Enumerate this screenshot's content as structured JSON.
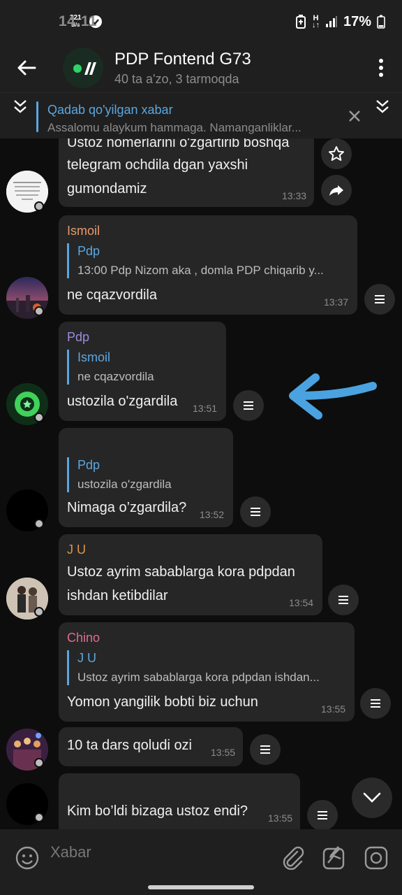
{
  "status": {
    "time": "14:11",
    "net_speed_value": "321",
    "net_speed_unit": "B/s",
    "battery": "17%"
  },
  "header": {
    "title": "PDP Fontend G73",
    "subtitle": "40 ta a'zo, 3 tarmoqda"
  },
  "pinned": {
    "title": "Qadab qo'yilgan xabar",
    "text": "Assalomu alaykum hammaga. Namanganliklar..."
  },
  "messages": [
    {
      "lines": [
        "Ustoz nomerlarini o'zgartirib boshqa",
        "telegram ochdila dgan yaxshi",
        "gumondamiz"
      ],
      "time": "13:33"
    },
    {
      "sender": "Ismoil",
      "reply_name": "Pdp",
      "reply_text": "13:00 Pdp Nizom aka , domla PDP chiqarib y...",
      "text": "ne cqazvordila",
      "time": "13:37"
    },
    {
      "sender": "Pdp",
      "reply_name": "Ismoil",
      "reply_text": "ne cqazvordila",
      "text": "ustozila o'zgardila",
      "time": "13:51"
    },
    {
      "reply_name": "Pdp",
      "reply_text": "ustozila o'zgardila",
      "text": "Nimaga o’zgardila?",
      "time": "13:52"
    },
    {
      "sender": "J U",
      "lines": [
        "Ustoz ayrim sabablarga kora pdpdan",
        "ishdan ketibdilar"
      ],
      "time": "13:54"
    },
    {
      "sender": "Chino",
      "reply_name": "J U",
      "reply_text": "Ustoz ayrim sabablarga kora pdpdan ishdan...",
      "text": "Yomon yangilik bobti biz uchun",
      "time": "13:55"
    },
    {
      "text": "10 ta dars qoludi ozi",
      "time": "13:55"
    },
    {
      "text": "Kim bo’ldi bizaga ustoz endi?",
      "time": "13:55"
    }
  ],
  "composer": {
    "placeholder": "Xabar"
  },
  "colors": {
    "accent": "#5aa7e0",
    "ismoil": "#e89a6b",
    "pdp": "#9e8be0",
    "ju": "#e0944a",
    "chino": "#e06b93",
    "annotation_arrow": "#4aa3e0"
  }
}
